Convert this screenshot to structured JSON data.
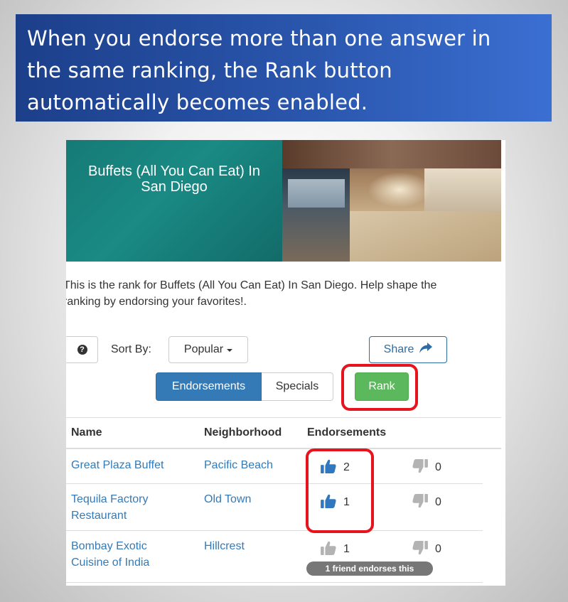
{
  "slide": {
    "caption_lines": [
      "When you endorse more than one answer in",
      "the same ranking, the Rank button",
      "automatically becomes enabled."
    ]
  },
  "hero": {
    "title_lines": [
      "Buffets (All You Can Eat) In",
      "San Diego"
    ]
  },
  "intro": {
    "line1": "This is the rank for Buffets (All You Can Eat) In San Diego. Help shape the",
    "line2": "ranking by endorsing your favorites!."
  },
  "controls": {
    "help_symbol": "?",
    "sort_label": "Sort By:",
    "sort_value": "Popular",
    "share_label": "Share",
    "tabs": [
      "Endorsements",
      "Specials"
    ],
    "active_tab": "Endorsements",
    "rank_label": "Rank"
  },
  "table": {
    "headers": [
      "Name",
      "Neighborhood",
      "Endorsements"
    ],
    "rows": [
      {
        "name_lines": [
          "Great Plaza Buffet"
        ],
        "neighborhood": "Pacific Beach",
        "up": "2",
        "down": "0",
        "up_active": true
      },
      {
        "name_lines": [
          "Tequila Factory",
          "Restaurant"
        ],
        "neighborhood": "Old Town",
        "up": "1",
        "down": "0",
        "up_active": true
      },
      {
        "name_lines": [
          "Bombay Exotic",
          "Cuisine of India"
        ],
        "neighborhood": "Hillcrest",
        "up": "1",
        "down": "0",
        "up_active": false,
        "badge": "1 friend endorses this"
      }
    ]
  },
  "colors": {
    "banner": "#2a56ad",
    "primary": "#337ab7",
    "success": "#5cb85c",
    "highlight": "#e8141d",
    "thumb_active": "#2f78c0",
    "thumb_inactive": "#b3b3b3"
  },
  "icons": {
    "help": "question-circle-icon",
    "share": "share-arrow-icon",
    "upvote": "thumbs-up-icon",
    "downvote": "thumbs-down-icon",
    "sort_caret": "caret-down-icon"
  }
}
